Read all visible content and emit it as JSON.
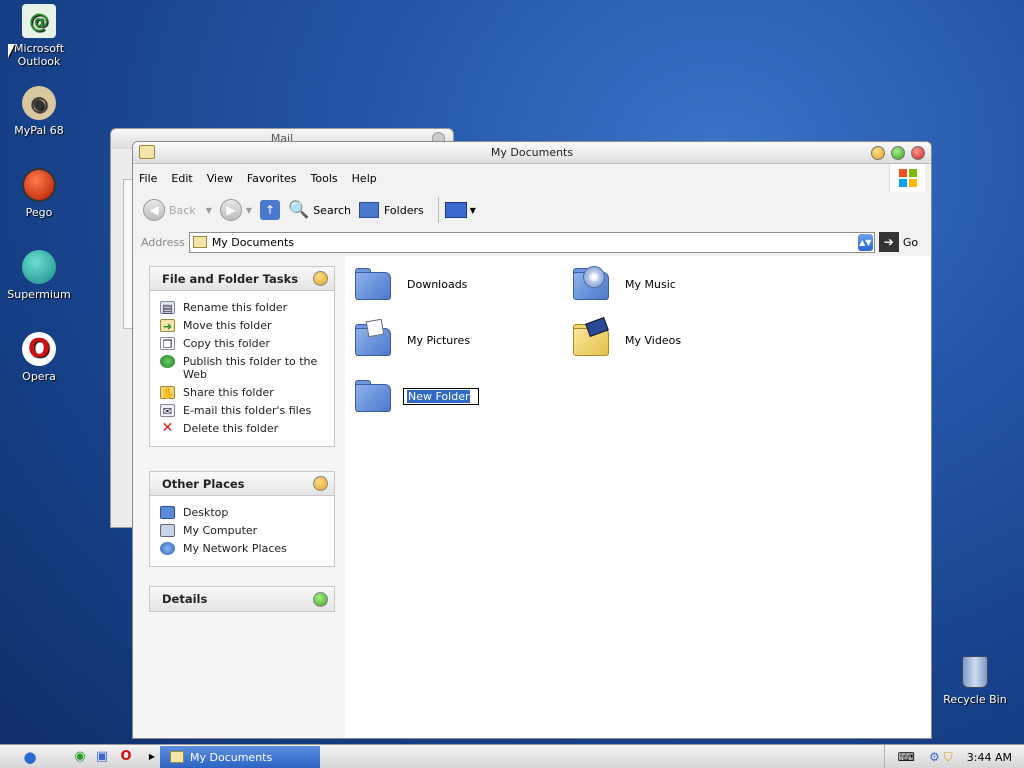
{
  "desktop": {
    "icons": [
      {
        "label": "Microsoft Outlook"
      },
      {
        "label": "MyPal 68"
      },
      {
        "label": "Pego"
      },
      {
        "label": "Supermium"
      },
      {
        "label": "Opera"
      }
    ],
    "recycle_bin": "Recycle Bin"
  },
  "mail_window": {
    "title": "Mail"
  },
  "window": {
    "title": "My Documents",
    "menu": [
      "File",
      "Edit",
      "View",
      "Favorites",
      "Tools",
      "Help"
    ],
    "toolbar": {
      "back": "Back",
      "search": "Search",
      "folders": "Folders"
    },
    "address": {
      "label": "Address",
      "value": "My Documents",
      "go": "Go"
    },
    "tasks_panel": {
      "title": "File and Folder Tasks",
      "items": [
        "Rename this folder",
        "Move this folder",
        "Copy this folder",
        "Publish this folder to the Web",
        "Share this folder",
        "E-mail this folder's files",
        "Delete this folder"
      ]
    },
    "places_panel": {
      "title": "Other Places",
      "items": [
        "Desktop",
        "My Computer",
        "My Network Places"
      ]
    },
    "details_panel": {
      "title": "Details"
    },
    "folders": [
      {
        "name": "Downloads"
      },
      {
        "name": "My Music"
      },
      {
        "name": "My Pictures"
      },
      {
        "name": "My Videos"
      },
      {
        "name": "New Folder",
        "renaming": true
      }
    ]
  },
  "taskbar": {
    "active_item": "My Documents",
    "clock": "3:44 AM"
  },
  "colors": {
    "selection": "#316ac5",
    "taskbar_item": "#2d63c4"
  }
}
